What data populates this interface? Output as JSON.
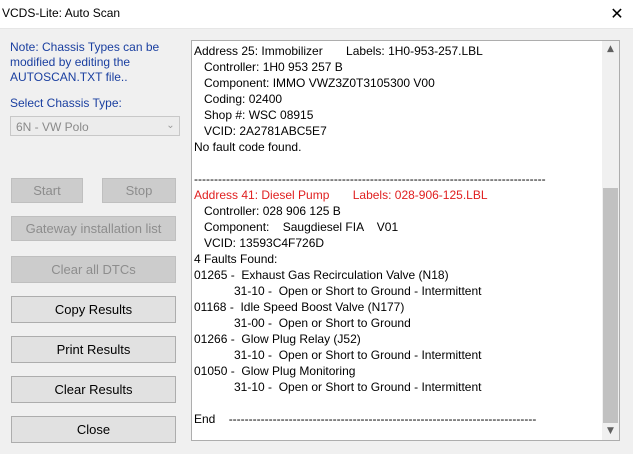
{
  "window": {
    "title": "VCDS-Lite: Auto Scan",
    "close_glyph": "✕"
  },
  "note": {
    "lines": [
      "Note:  Chassis Types can be",
      "modified by editing the",
      "AUTOSCAN.TXT file.."
    ]
  },
  "chassis": {
    "label": "Select Chassis Type:",
    "selected": "6N - VW Polo",
    "enabled": false
  },
  "buttons": {
    "start": "Start",
    "stop": "Stop",
    "gateway": "Gateway installation list",
    "clear_dtcs": "Clear all DTCs",
    "copy": "Copy Results",
    "print": "Print Results",
    "clear_results": "Clear Results",
    "close": "Close"
  },
  "log_lines": [
    "Address 25: Immobilizer       Labels: 1H0-953-257.LBL",
    "   Controller: 1H0 953 257 B",
    "   Component: IMMO VWZ3Z0T3105300 V00",
    "   Coding: 02400",
    "   Shop #: WSC 08915",
    "   VCID: 2A2781ABC5E7",
    "No fault code found.",
    "",
    "----------------------------------------------------------------------------------------",
    "Address 41: Diesel Pump       Labels: 028-906-125.LBL",
    "   Controller: 028 906 125 B",
    "   Component:    Saugdiesel FIA    V01",
    "   VCID: 13593C4F726D",
    "4 Faults Found:",
    "01265 -  Exhaust Gas Recirculation Valve (N18)",
    "            31-10 -  Open or Short to Ground - Intermittent",
    "01168 -  Idle Speed Boost Valve (N177)",
    "            31-00 -  Open or Short to Ground",
    "01266 -  Glow Plug Relay (J52)",
    "            31-10 -  Open or Short to Ground - Intermittent",
    "01050 -  Glow Plug Monitoring",
    "            31-10 -  Open or Short to Ground - Intermittent",
    "",
    "End    -----------------------------------------------------------------------------"
  ],
  "red_line_index": 9,
  "colors": {
    "note_text": "#1a3fa0",
    "highlight": "#e02020"
  }
}
